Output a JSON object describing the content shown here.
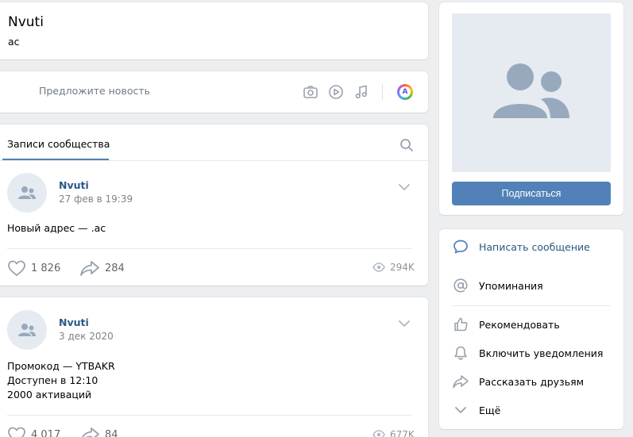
{
  "group": {
    "name": "Nvuti",
    "status": "ac"
  },
  "composer": {
    "placeholder": "Предложите новость",
    "tools": [
      "camera-icon",
      "video-icon",
      "music-icon"
    ],
    "avatar_letter": "A"
  },
  "feed": {
    "tab_label": "Записи сообщества",
    "posts": [
      {
        "author": "Nvuti",
        "date": "27 фев в 19:39",
        "lines": [
          "Новый адрес — .ac"
        ],
        "likes": "1 826",
        "shares": "284",
        "views": "294K"
      },
      {
        "author": "Nvuti",
        "date": "3 дек 2020",
        "lines": [
          "Промокод — YTBAKR",
          "Доступен в 12:10",
          "2000 активаций"
        ],
        "likes": "4 017",
        "shares": "84",
        "views": "677K"
      }
    ]
  },
  "sidebar": {
    "subscribe_label": "Подписаться",
    "actions": [
      {
        "label": "Написать сообщение",
        "icon": "message-icon"
      },
      {
        "label": "Упоминания",
        "icon": "at-icon"
      },
      {
        "label": "Рекомендовать",
        "icon": "thumbs-up-icon"
      },
      {
        "label": "Включить уведомления",
        "icon": "bell-icon"
      },
      {
        "label": "Рассказать друзьям",
        "icon": "share-icon"
      },
      {
        "label": "Ещё",
        "icon": "chevron-down-icon"
      }
    ]
  },
  "colors": {
    "accent": "#5181b8",
    "link": "#2a5885",
    "background": "#edeef0",
    "icon": "#99a2ad"
  }
}
